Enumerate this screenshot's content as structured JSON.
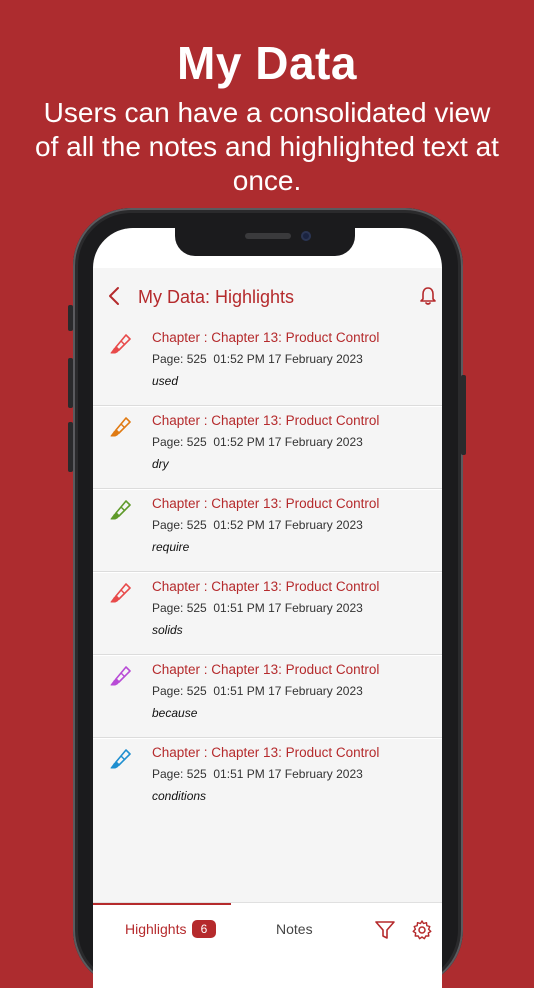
{
  "promo": {
    "title": "My Data",
    "subtitle": "Users can have a consolidated view of all the notes and highlighted text at once."
  },
  "colors": {
    "background": "#ad2c2f",
    "accent": "#b52a2c",
    "highlighter_colors": [
      "#e84a4a",
      "#e07a12",
      "#5f9a2a",
      "#e84a4a",
      "#b84bd6",
      "#1f8fd0"
    ]
  },
  "header": {
    "back_icon": "chevron-left-icon",
    "title": "My Data: Highlights",
    "bell_icon": "bell-icon"
  },
  "highlights": [
    {
      "chapter": "Chapter : Chapter 13: Product Control",
      "meta": "Page: 525  01:52 PM 17 February 2023",
      "text": "used",
      "color": "#e84a4a"
    },
    {
      "chapter": "Chapter : Chapter 13: Product Control",
      "meta": "Page: 525  01:52 PM 17 February 2023",
      "text": "dry",
      "color": "#e07a12"
    },
    {
      "chapter": "Chapter : Chapter 13: Product Control",
      "meta": "Page: 525  01:52 PM 17 February 2023",
      "text": "require",
      "color": "#5f9a2a"
    },
    {
      "chapter": "Chapter : Chapter 13: Product Control",
      "meta": "Page: 525  01:51 PM 17 February 2023",
      "text": "solids",
      "color": "#e84a4a"
    },
    {
      "chapter": "Chapter : Chapter 13: Product Control",
      "meta": "Page: 525  01:51 PM 17 February 2023",
      "text": "because",
      "color": "#b84bd6"
    },
    {
      "chapter": "Chapter : Chapter 13: Product Control",
      "meta": "Page: 525  01:51 PM 17 February 2023",
      "text": "conditions",
      "color": "#1f8fd0"
    }
  ],
  "tabbar": {
    "highlights_label": "Highlights",
    "highlights_count": "6",
    "notes_label": "Notes",
    "filter_icon": "filter-icon",
    "settings_icon": "gear-icon"
  }
}
